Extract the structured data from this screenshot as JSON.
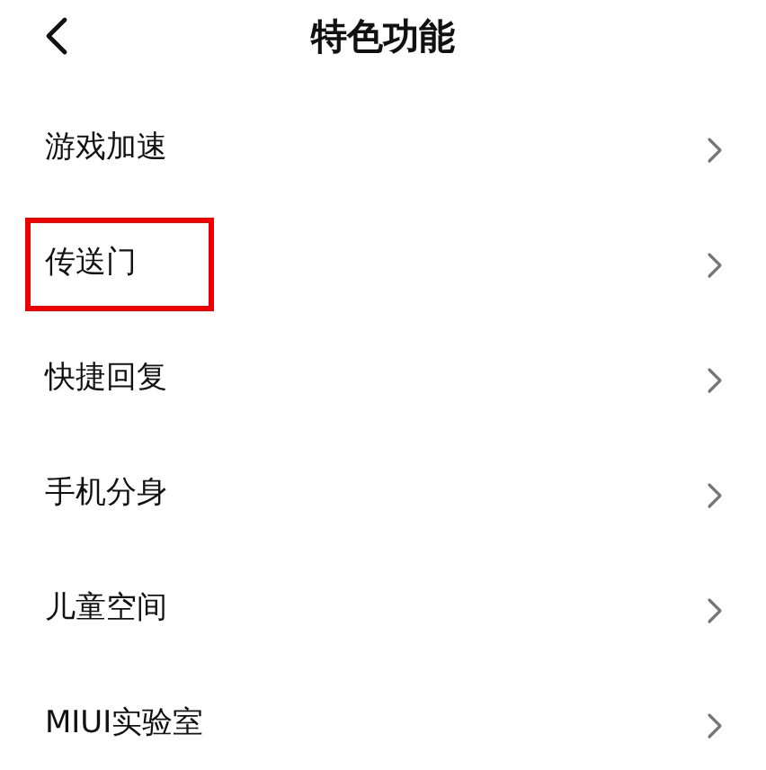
{
  "header": {
    "title": "特色功能"
  },
  "items": [
    {
      "label": "游戏加速",
      "highlighted": false
    },
    {
      "label": "传送门",
      "highlighted": true
    },
    {
      "label": "快捷回复",
      "highlighted": false
    },
    {
      "label": "手机分身",
      "highlighted": false
    },
    {
      "label": "儿童空间",
      "highlighted": false
    },
    {
      "label": "MIUI实验室",
      "highlighted": false
    }
  ]
}
